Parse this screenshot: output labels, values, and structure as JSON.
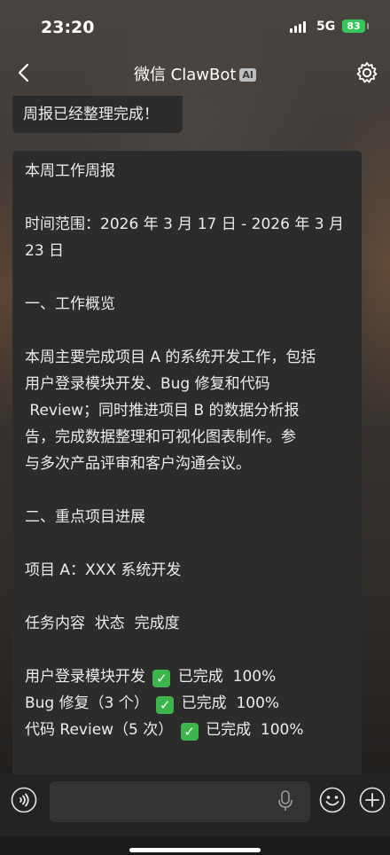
{
  "status": {
    "time": "23:20",
    "network": "5G",
    "battery": "83"
  },
  "nav": {
    "title": "微信 ClawBot",
    "ai_badge": "AI",
    "back_icon": "chevron-left-icon",
    "settings_icon": "gear-icon"
  },
  "messages": {
    "top": "周报已经整理完成！",
    "report": {
      "heading": "本周工作周报",
      "range_line1": "时间范围：2026 年 3 月 17 日 - 2026 年 3 月",
      "range_line2": "23 日",
      "section1": "一、工作概览",
      "overview_lines": [
        "本周主要完成项目 A 的系统开发工作，包括",
        "用户登录模块开发、Bug 修复和代码",
        " Review；同时推进项目 B 的数据分析报",
        "告，完成数据整理和可视化图表制作。参",
        "与多次产品评审和客户沟通会议。"
      ],
      "section2": "二、重点项目进展",
      "project_a": "项目 A：XXX 系统开发",
      "table_header": "任务内容  状态  完成度",
      "rows": [
        {
          "task": "用户登录模块开发",
          "status": "已完成",
          "progress": "100%"
        },
        {
          "task": "Bug 修复（3 个）",
          "status": "已完成",
          "progress": "100%"
        },
        {
          "task": "代码 Review（5 次）",
          "status": "已完成",
          "progress": "100%"
        }
      ]
    }
  },
  "input": {
    "placeholder": ""
  }
}
